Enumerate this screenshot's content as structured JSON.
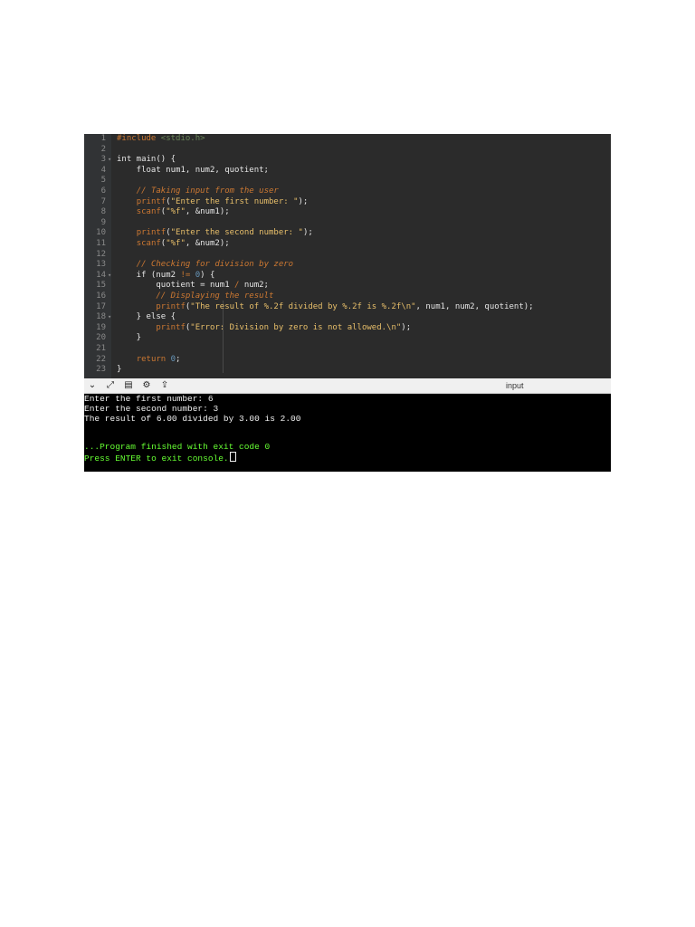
{
  "editor": {
    "line_numbers": [
      "1",
      "2",
      "3",
      "4",
      "5",
      "6",
      "7",
      "8",
      "9",
      "10",
      "11",
      "12",
      "13",
      "14",
      "15",
      "16",
      "17",
      "18",
      "19",
      "20",
      "21",
      "22",
      "23"
    ],
    "fold_markers": {
      "3": "▾",
      "14": "▾",
      "18": "▾"
    },
    "lines": [
      "#include <stdio.h>",
      "",
      "int main() {",
      "    float num1, num2, quotient;",
      "",
      "    // Taking input from the user",
      "    printf(\"Enter the first number: \");",
      "    scanf(\"%f\", &num1);",
      "",
      "    printf(\"Enter the second number: \");",
      "    scanf(\"%f\", &num2);",
      "",
      "    // Checking for division by zero",
      "    if (num2 != 0) {",
      "        quotient = num1 / num2;",
      "        // Displaying the result",
      "        printf(\"The result of %.2f divided by %.2f is %.2f\\n\", num1, num2, quotient);",
      "    } else {",
      "        printf(\"Error: Division by zero is not allowed.\\n\");",
      "    }",
      "",
      "    return 0;",
      "}"
    ]
  },
  "toolbar": {
    "icons": [
      "chevron-down-icon",
      "expand-icon",
      "copy-icon",
      "gear-icon",
      "share-icon"
    ],
    "glyphs": [
      "⌄",
      "⤢",
      "▤",
      "⚙",
      "⇪"
    ],
    "input_label": "input"
  },
  "console": {
    "lines": [
      "Enter the first number: 6",
      "Enter the second number: 3",
      "The result of 6.00 divided by 3.00 is 2.00",
      "",
      "",
      "...Program finished with exit code 0",
      "Press ENTER to exit console."
    ]
  }
}
